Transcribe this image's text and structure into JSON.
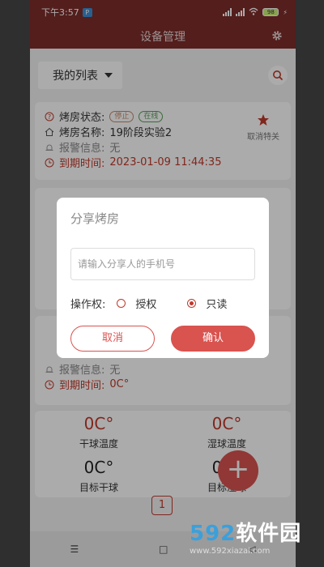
{
  "status": {
    "time": "下午3:57",
    "battery": "98"
  },
  "appbar": {
    "title": "设备管理"
  },
  "list": {
    "selector": "我的列表"
  },
  "card1": {
    "status_label": "烤房状态:",
    "tag_stop": "停止",
    "tag_online": "在线",
    "name_label": "烤房名称:",
    "name_value": "19阶段实验2",
    "alarm_label": "报警信息:",
    "alarm_value": "无",
    "expire_label": "到期时间:",
    "expire_value": "2023-01-09 11:44:35",
    "fav_label": "取消特关"
  },
  "card2": {
    "alarm_label": "报警信息:",
    "alarm_value": "无",
    "expire_label": "到期时间:",
    "expire_value": "0C°"
  },
  "metrics": [
    {
      "value": "0C°",
      "label": "干球温度"
    },
    {
      "value": "0C°",
      "label": "湿球温度"
    },
    {
      "value": "0C°",
      "label": "目标干球"
    },
    {
      "value": "0C°",
      "label": "目标湿球"
    }
  ],
  "pager": {
    "page": "1"
  },
  "dialog": {
    "title": "分享烤房",
    "placeholder": "请输入分享人的手机号",
    "perm_label": "操作权:",
    "opt_auth": "授权",
    "opt_read": "只读",
    "selected": "只读",
    "cancel": "取消",
    "confirm": "确认"
  },
  "watermark": {
    "brand_a": "592",
    "brand_b": "软件园",
    "url": "www.592xiazai.com"
  },
  "colors": {
    "appbar": "#7d2e2b",
    "accent": "#d9534f",
    "danger_text": "#c0392b"
  }
}
